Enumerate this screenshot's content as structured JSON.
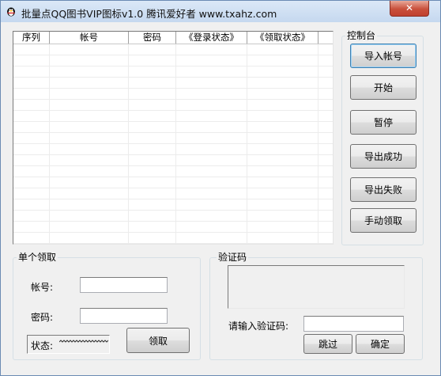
{
  "window": {
    "title": "批量点QQ图书VIP图标v1.0 腾讯爱好者 www.txahz.com",
    "close_label": "✕"
  },
  "table": {
    "columns": [
      "序列",
      "帐号",
      "密码",
      "《登录状态》",
      "《领取状态》"
    ]
  },
  "control_panel": {
    "title": "控制台",
    "buttons": [
      "导入帐号",
      "开始",
      "暂停",
      "导出成功",
      "导出失败",
      "手动领取"
    ]
  },
  "single": {
    "title": "单个领取",
    "account_label": "帐号:",
    "password_label": "密码:",
    "status_label": "状态:",
    "account_value": "",
    "password_value": "",
    "claim_button": "领取"
  },
  "captcha": {
    "title": "验证码",
    "input_label": "请输入验证码:",
    "input_value": "",
    "skip_button": "跳过",
    "confirm_button": "确定"
  },
  "colors": {
    "titlebar": "#c5d8ef",
    "close_button": "#c9503b",
    "default_button_border": "#3c7fb1"
  },
  "icons": {
    "app_icon": "penguin-icon",
    "close_icon": "close-icon"
  }
}
